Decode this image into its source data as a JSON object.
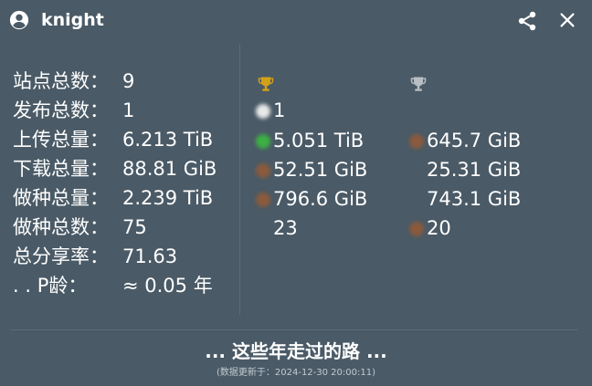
{
  "header": {
    "username": "knight",
    "user_icon": "account-circle-icon",
    "share_icon": "share-icon",
    "close_icon": "close-icon"
  },
  "stats": [
    {
      "label": "站点总数：",
      "value": "9"
    },
    {
      "label": "发布总数：",
      "value": "1"
    },
    {
      "label": "上传总量：",
      "value": "6.213 TiB"
    },
    {
      "label": "下载总量：",
      "value": "88.81 GiB"
    },
    {
      "label": "做种总量：",
      "value": "2.239 TiB"
    },
    {
      "label": "做种总数：",
      "value": "75"
    },
    {
      "label": "总分享率：",
      "value": "71.63"
    },
    {
      "label": ". . P龄：",
      "value": "≈ 0.05 年"
    }
  ],
  "rankings": {
    "gold": {
      "icon": "trophy-gold-icon",
      "color": "#d4a017",
      "values": [
        "1",
        "5.051 TiB",
        "52.51 GiB",
        "796.6 GiB",
        "23"
      ]
    },
    "silver": {
      "icon": "trophy-silver-icon",
      "color": "#b8bec4",
      "values": [
        "645.7 GiB",
        "25.31 GiB",
        "743.1 GiB",
        "20"
      ]
    }
  },
  "footer": {
    "title": "... 这些年走过的路 ...",
    "updated": "(数据更新于：2024-12-30 20:00:11)"
  }
}
